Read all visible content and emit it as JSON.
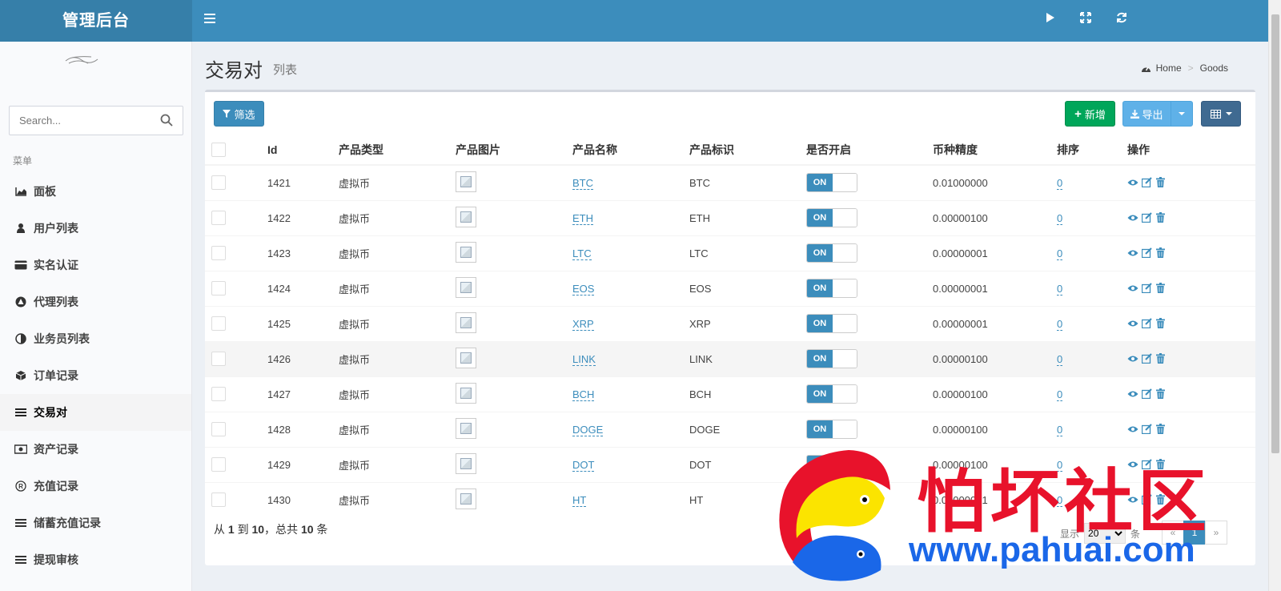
{
  "header": {
    "logo": "管理后台"
  },
  "sidebar": {
    "search_placeholder": "Search...",
    "menu_header": "菜单",
    "items": [
      {
        "label": "面板",
        "icon": "area-chart-icon"
      },
      {
        "label": "用户列表",
        "icon": "user-icon"
      },
      {
        "label": "实名认证",
        "icon": "credit-card-icon"
      },
      {
        "label": "代理列表",
        "icon": "triangle-icon"
      },
      {
        "label": "业务员列表",
        "icon": "adjust-icon"
      },
      {
        "label": "订单记录",
        "icon": "cube-icon"
      },
      {
        "label": "交易对",
        "icon": "list-icon"
      },
      {
        "label": "资产记录",
        "icon": "money-icon"
      },
      {
        "label": "充值记录",
        "icon": "registered-icon"
      },
      {
        "label": "储蓄充值记录",
        "icon": "list-icon"
      },
      {
        "label": "提现审核",
        "icon": "list-icon"
      }
    ]
  },
  "content": {
    "title": "交易对",
    "subtitle": "列表",
    "breadcrumb": {
      "home": "Home",
      "current": "Goods"
    }
  },
  "toolbar": {
    "filter": "筛选",
    "new": "新增",
    "export": "导出"
  },
  "table": {
    "headers": [
      "Id",
      "产品类型",
      "产品图片",
      "产品名称",
      "产品标识",
      "是否开启",
      "币种精度",
      "排序",
      "操作"
    ],
    "toggle_on": "ON",
    "rows": [
      {
        "id": "1421",
        "type": "虚拟币",
        "name": "BTC",
        "symbol": "BTC",
        "precision": "0.01000000",
        "sort": "0"
      },
      {
        "id": "1422",
        "type": "虚拟币",
        "name": "ETH",
        "symbol": "ETH",
        "precision": "0.00000100",
        "sort": "0"
      },
      {
        "id": "1423",
        "type": "虚拟币",
        "name": "LTC",
        "symbol": "LTC",
        "precision": "0.00000001",
        "sort": "0"
      },
      {
        "id": "1424",
        "type": "虚拟币",
        "name": "EOS",
        "symbol": "EOS",
        "precision": "0.00000001",
        "sort": "0"
      },
      {
        "id": "1425",
        "type": "虚拟币",
        "name": "XRP",
        "symbol": "XRP",
        "precision": "0.00000001",
        "sort": "0"
      },
      {
        "id": "1426",
        "type": "虚拟币",
        "name": "LINK",
        "symbol": "LINK",
        "precision": "0.00000100",
        "sort": "0"
      },
      {
        "id": "1427",
        "type": "虚拟币",
        "name": "BCH",
        "symbol": "BCH",
        "precision": "0.00000100",
        "sort": "0"
      },
      {
        "id": "1428",
        "type": "虚拟币",
        "name": "DOGE",
        "symbol": "DOGE",
        "precision": "0.00000100",
        "sort": "0"
      },
      {
        "id": "1429",
        "type": "虚拟币",
        "name": "DOT",
        "symbol": "DOT",
        "precision": "0.00000100",
        "sort": "0"
      },
      {
        "id": "1430",
        "type": "虚拟币",
        "name": "HT",
        "symbol": "HT",
        "precision": "0.00000001",
        "sort": "0"
      }
    ]
  },
  "pagination": {
    "info_prefix": "从",
    "from": "1",
    "to_word": "到",
    "to": "10",
    "total_prefix": "，总共",
    "total": "10",
    "unit": "条",
    "show_label": "显示",
    "page_size": "20",
    "page_size_unit": "条",
    "prev": "«",
    "current": "1",
    "next": "»"
  },
  "watermark": {
    "text": "怕坏社区",
    "url": "www.pahuai.com"
  },
  "colors": {
    "primary": "#3c8dbc",
    "success": "#00a65a",
    "export": "#5fb1e8",
    "columns": "#3f6a91",
    "watermark_red": "#e8122b",
    "watermark_blue": "#1a67e8"
  }
}
